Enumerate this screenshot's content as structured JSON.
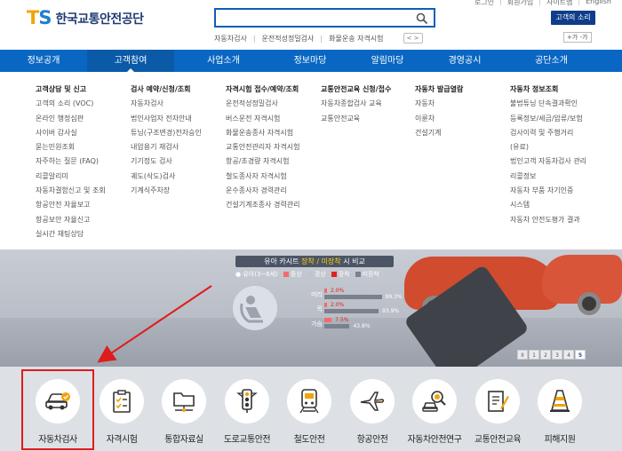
{
  "util_links": [
    "로그인",
    "회원가입",
    "사이트맵",
    "English"
  ],
  "logo": {
    "mark_t": "T",
    "mark_s": "S",
    "name": "한국교통안전공단"
  },
  "search": {
    "placeholder": ""
  },
  "popular": [
    "자동차검사",
    "운전적성정밀검사",
    "화물운송 자격시험"
  ],
  "popular_nav": "< >",
  "voice_button": "고객의 소리",
  "text_size": "+가 -가",
  "gnb": [
    {
      "label": "정보공개",
      "active": false
    },
    {
      "label": "고객참여",
      "active": true
    },
    {
      "label": "사업소개",
      "active": false
    },
    {
      "label": "정보마당",
      "active": false
    },
    {
      "label": "알림마당",
      "active": false
    },
    {
      "label": "경영공시",
      "active": false
    },
    {
      "label": "공단소개",
      "active": false
    }
  ],
  "mega": [
    {
      "head": "고객상담 및 신고",
      "items": [
        "고객의 소리 (VOC)",
        "온라인 행정심판",
        "사이버 감사실",
        "묻는민원조회",
        "자주하는 질문 (FAQ)",
        "리콜알리미",
        "자동차결함신고 및 조회",
        "항공안전 자율보고",
        "항공보안 자율신고",
        "실시간 채팅상담"
      ]
    },
    {
      "head": "검사 예약/신청/조회",
      "items": [
        "자동차검사",
        "법인사업자 전자안내",
        "튜닝(구조변경)전자승인",
        "내압용기 재검사",
        "기기정도 검사",
        "궤도(삭도)검사",
        "기계식주차장"
      ]
    },
    {
      "head": "자격시험 접수/예약/조회",
      "items": [
        "운전적성정밀검사",
        "버스운전 자격시험",
        "화물운송종사 자격시험",
        "교통안전관리자 자격시험",
        "항공/초경량 자격시험",
        "철도종사자 자격시험",
        "운수종사자 경력관리",
        "건설기계조종사 경력관리"
      ]
    },
    {
      "head": "교통안전교육 신청/접수",
      "items": [
        "자동차종합검사 교육",
        "교통안전교육"
      ]
    },
    {
      "head": "자동차 발급열람",
      "items": [
        "자동차",
        "이륜차",
        "건설기계"
      ]
    },
    {
      "head": "자동차 정보조회",
      "items": [
        "불법튜닝 단속결과확인",
        "등록정보/세금/압류/보험",
        "검사이력 및 주행거리",
        "(유료)",
        "법인고객 자동차검사 관리",
        "리콜정보",
        "자동차 부품 자기인증",
        "시스템",
        "자동차 안전도평가 결과"
      ]
    }
  ],
  "banner": {
    "title_pre": "유아 카시트 ",
    "title_hl": "장착 / 미장착",
    "title_post": " 시 비교",
    "legend": [
      "유아(3~6세)",
      "중상",
      "경상",
      "장착",
      "미장착"
    ],
    "rows": [
      {
        "label": "머리",
        "injured": "2.0%",
        "injured_val": 2.0,
        "safe": "99.3%",
        "safe_val": 99.3
      },
      {
        "label": "목",
        "injured": "2.0%",
        "injured_val": 2.0,
        "safe": "93.9%",
        "safe_val": 93.9
      },
      {
        "label": "가슴",
        "injured": "7.5%",
        "injured_val": 7.5,
        "safe": "43.8%",
        "safe_val": 43.8
      }
    ],
    "pager": [
      "II",
      "1",
      "2",
      "3",
      "4",
      "5"
    ],
    "pager_active": 5
  },
  "quick": [
    {
      "label": "자동차검사",
      "icon": "car-inspection-icon"
    },
    {
      "label": "자격시험",
      "icon": "clipboard-checklist-icon"
    },
    {
      "label": "통합자료실",
      "icon": "folder-network-icon"
    },
    {
      "label": "도로교통안전",
      "icon": "traffic-light-icon"
    },
    {
      "label": "철도안전",
      "icon": "train-icon"
    },
    {
      "label": "항공안전",
      "icon": "airplane-icon"
    },
    {
      "label": "자동차안전연구",
      "icon": "car-magnifier-icon"
    },
    {
      "label": "교통안전교육",
      "icon": "document-pencil-icon"
    },
    {
      "label": "피해지원",
      "icon": "traffic-cone-icon"
    }
  ],
  "colors": {
    "gnb": "#0967c3",
    "highlight": "#e01b1b",
    "quick_bg": "#dde1e6",
    "accent_icon": "#f0a30a"
  }
}
